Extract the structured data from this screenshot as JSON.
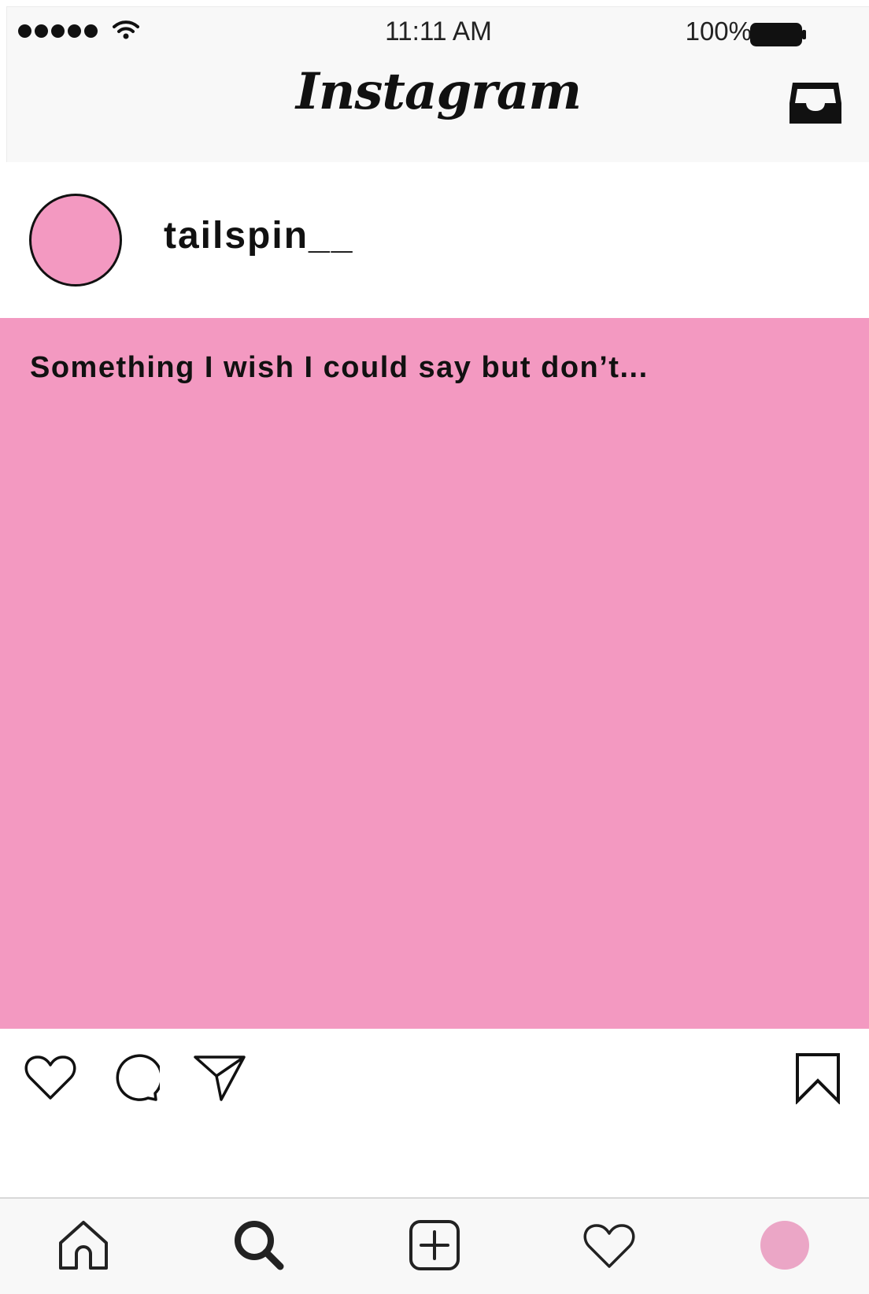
{
  "status_bar": {
    "time": "11:11 AM",
    "battery_percent": "100%",
    "signal_bars": 5,
    "icons": [
      "signal-dots-icon",
      "wifi-icon",
      "battery-icon"
    ]
  },
  "header": {
    "app_title": "Instagram",
    "right_icon": "inbox-icon"
  },
  "post": {
    "username": "tailspin__",
    "avatar_color": "#f399c1",
    "image_color": "#f399c1",
    "image_text": "Something I wish I could say but don’t...",
    "actions": [
      "heart-icon",
      "comment-icon",
      "send-icon"
    ],
    "save_icon": "bookmark-icon"
  },
  "tab_bar": {
    "tabs": [
      "home-icon",
      "search-icon",
      "add-post-icon",
      "activity-heart-icon",
      "profile-avatar"
    ],
    "profile_color": "#eba6c6"
  }
}
